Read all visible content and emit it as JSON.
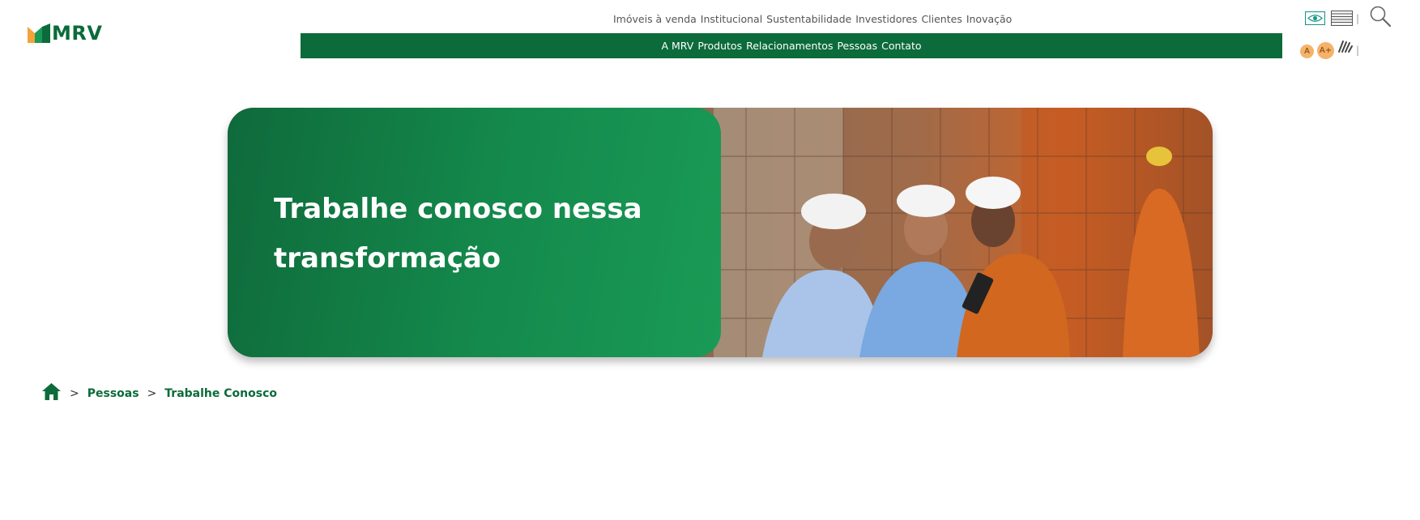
{
  "logo": {
    "text": "MRV"
  },
  "top_nav": {
    "items": [
      {
        "label": "Imóveis à venda"
      },
      {
        "label": "Institucional"
      },
      {
        "label": "Sustentabilidade"
      },
      {
        "label": "Investidores"
      },
      {
        "label": "Clientes"
      },
      {
        "label": "Inovação"
      }
    ]
  },
  "main_nav": {
    "items": [
      {
        "label": "A MRV"
      },
      {
        "label": "Produtos"
      },
      {
        "label": "Relacionamentos"
      },
      {
        "label": "Pessoas"
      },
      {
        "label": "Contato"
      }
    ]
  },
  "accessibility": {
    "separator": "|",
    "font_decrease": "A",
    "font_increase": "A+",
    "icons": [
      "eye-contrast-icon",
      "flag-icon",
      "search-icon",
      "sign-language-icon"
    ]
  },
  "hero": {
    "title_line1": "Trabalhe conosco nessa",
    "title_line2": "transformação"
  },
  "breadcrumb": {
    "separator": ">",
    "items": [
      {
        "label": "Pessoas"
      },
      {
        "label": "Trabalhe Conosco"
      }
    ]
  },
  "colors": {
    "brand_green": "#0c6b3a",
    "hero_green": "#148a4c",
    "accent_orange": "#f4a23b",
    "accent_light_orange": "#f4b36a"
  }
}
